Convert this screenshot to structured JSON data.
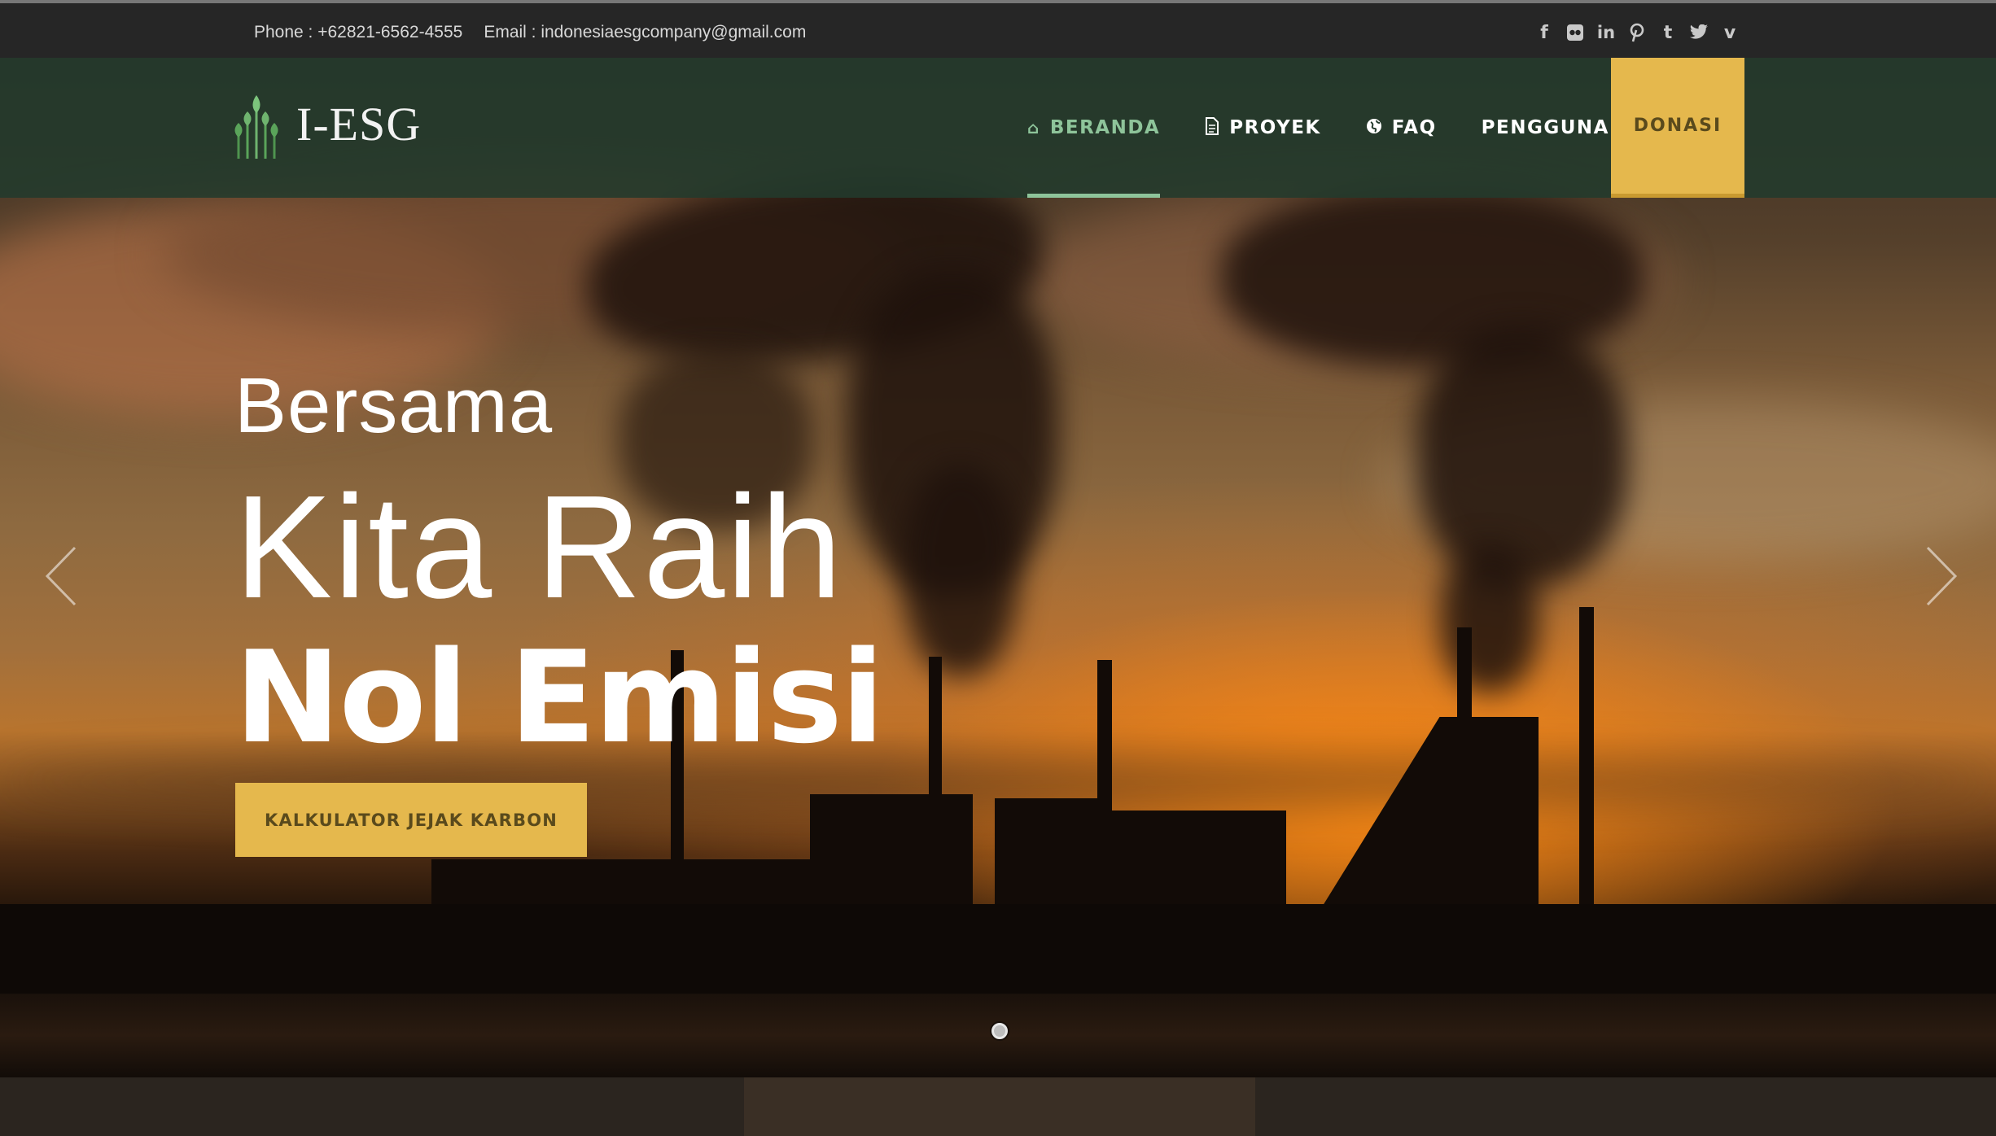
{
  "topbar": {
    "phone": "Phone : +62821-6562-4555",
    "email": "Email : indonesiaesgcompany@gmail.com",
    "social_icons": [
      "facebook-icon",
      "flickr-icon",
      "linkedin-icon",
      "pinterest-icon",
      "tumblr-icon",
      "twitter-icon",
      "vimeo-icon"
    ]
  },
  "brand": {
    "name": "I-ESG"
  },
  "nav": {
    "items": [
      {
        "label": "BERANDA",
        "icon": "home-icon",
        "active": true
      },
      {
        "label": "PROYEK",
        "icon": "document-icon",
        "active": false
      },
      {
        "label": "FAQ",
        "icon": "globe-icon",
        "active": false
      },
      {
        "label": "PENGGUNA",
        "icon": "",
        "active": false
      }
    ],
    "donate": "DONASI"
  },
  "hero": {
    "line1": "Bersama",
    "line2": "Kita Raih",
    "line3": "Nol Emisi",
    "cta": "KALKULATOR JEJAK KARBON",
    "slides": 1,
    "active_slide": 1
  },
  "colors": {
    "accent": "#e5b84d",
    "nav_active": "#8ec49a",
    "navbar": "#223a2c",
    "topbar": "#262626"
  }
}
